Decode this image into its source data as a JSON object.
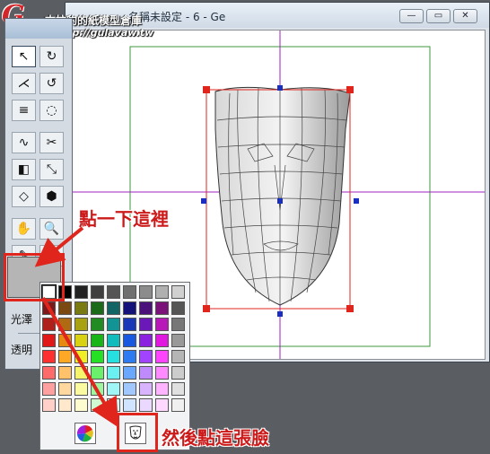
{
  "window": {
    "title": "名稱未設定 - 6 - Ge",
    "minimize_glyph": "—",
    "restore_glyph": "▭",
    "close_glyph": "✕"
  },
  "watermark": {
    "logo_letter": "G",
    "site_name": "古拉豹的紙模型倉庫",
    "url": "http://gulavaw.tw"
  },
  "tools": {
    "items": [
      {
        "name": "select-arrow-icon",
        "glyph": "↖",
        "selected": true
      },
      {
        "name": "rotate-icon",
        "glyph": "↻",
        "selected": false
      },
      {
        "name": "bend-icon",
        "glyph": "⋌",
        "selected": false
      },
      {
        "name": "rotate-alt-icon",
        "glyph": "↺",
        "selected": false
      },
      {
        "name": "align-icon",
        "glyph": "≡",
        "selected": false
      },
      {
        "name": "lasso-icon",
        "glyph": "◌",
        "selected": false
      },
      {
        "name": "pen-path-icon",
        "glyph": "∿",
        "selected": false
      },
      {
        "name": "scissors-icon",
        "glyph": "✂",
        "selected": false
      },
      {
        "name": "extrude-icon",
        "glyph": "◧",
        "selected": false
      },
      {
        "name": "scale-icon",
        "glyph": "⤡",
        "selected": false
      },
      {
        "name": "face-icon",
        "glyph": "◇",
        "selected": false
      },
      {
        "name": "cube-icon",
        "glyph": "⬢",
        "selected": false
      },
      {
        "name": "hand-icon",
        "glyph": "✋",
        "selected": false
      },
      {
        "name": "magnify-icon",
        "glyph": "🔍",
        "selected": false
      },
      {
        "name": "eyedropper-icon",
        "glyph": "✎",
        "selected": false
      },
      {
        "name": "paint-bucket-icon",
        "glyph": "⛋",
        "selected": false
      }
    ],
    "label_gloss": "光澤",
    "label_transparent": "透明"
  },
  "color_popup": {
    "rows": [
      [
        "#ffffff",
        "#000000",
        "#222222",
        "#3f3f3f",
        "#555555",
        "#707070",
        "#8c8c8c",
        "#b0b0b0",
        "#d0d0d0"
      ],
      [
        "#7a1a1a",
        "#7a4a12",
        "#7a7a12",
        "#1a6a1a",
        "#136464",
        "#12127a",
        "#4a127a",
        "#7a127a",
        "#555555"
      ],
      [
        "#b0201a",
        "#b06a12",
        "#a8a212",
        "#228c22",
        "#129494",
        "#1838b8",
        "#6a18b8",
        "#b818b8",
        "#777777"
      ],
      [
        "#e01818",
        "#e68a12",
        "#d8d212",
        "#18b418",
        "#12bcbc",
        "#1858e0",
        "#8a22e0",
        "#e018e0",
        "#999999"
      ],
      [
        "#ff3030",
        "#ffa826",
        "#f0ee26",
        "#26e026",
        "#26e0e0",
        "#2e7af0",
        "#a244ff",
        "#ff44ff",
        "#b5b5b5"
      ],
      [
        "#ff6a6a",
        "#ffc26a",
        "#f6f46a",
        "#6af06a",
        "#6af0f0",
        "#6aa8ff",
        "#c08aff",
        "#ff8aff",
        "#cccccc"
      ],
      [
        "#ffa0a0",
        "#ffd8a0",
        "#fafaa0",
        "#a0f6a0",
        "#a0f6f6",
        "#a0c8ff",
        "#d8b4ff",
        "#ffb4ff",
        "#e0e0e0"
      ],
      [
        "#ffd0c8",
        "#ffe8cc",
        "#fcfcd0",
        "#d0fad0",
        "#d0fafa",
        "#d0e4ff",
        "#ead8ff",
        "#ffd8ff",
        "#f0f0f0"
      ]
    ],
    "selected_index": 0,
    "wheel_icon": "color-wheel-icon",
    "face_icon": "face-texture-icon"
  },
  "swatch": {
    "color": "#b5b5b5"
  },
  "annotations": {
    "click_here": "點一下這裡",
    "then_click_face": "然後點這張臉"
  },
  "accent": "#e0261c"
}
